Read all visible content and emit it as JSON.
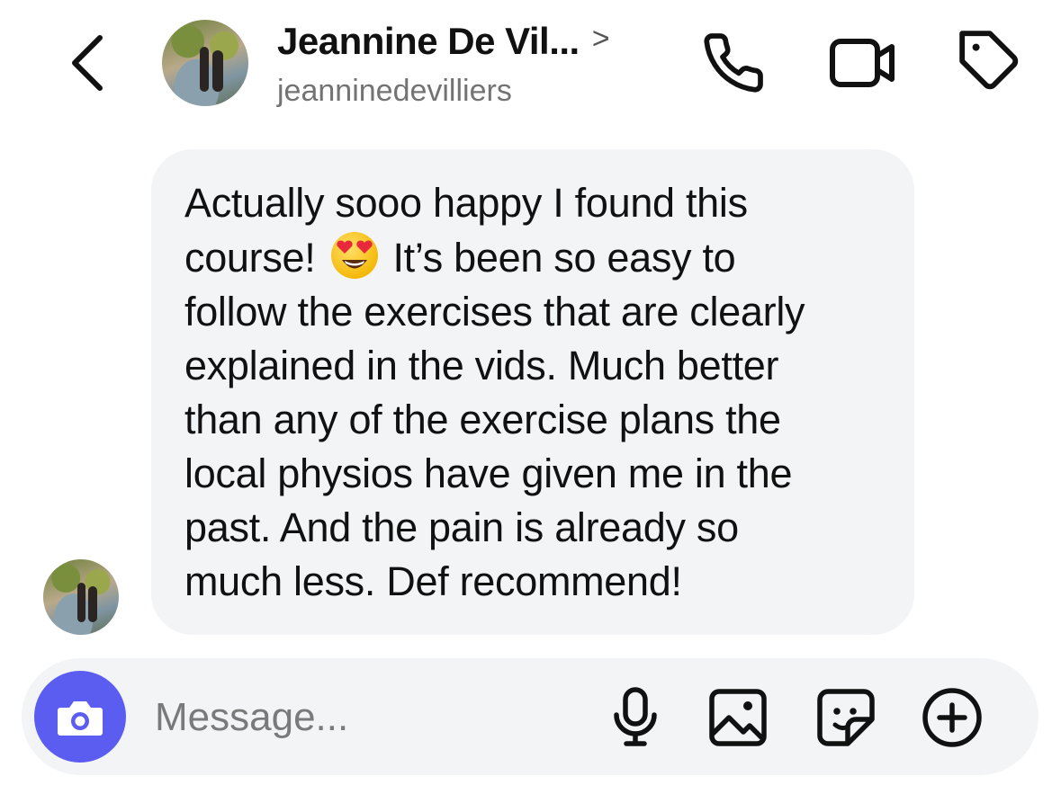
{
  "header": {
    "contact_name": "Jeannine De Vil...",
    "chevron": ">",
    "username": "jeanninedevilliers",
    "icons": {
      "back": "chevron-left-icon",
      "call": "phone-icon",
      "video": "video-camera-icon",
      "tag": "tag-icon"
    }
  },
  "conversation": {
    "message": {
      "text_before_emoji": "Actually sooo happy I found this\ncourse!",
      "emoji": "heart-eyes-emoji",
      "text_after_emoji": "It’s been so easy to\nfollow the exercises that are clearly\nexplained in the vids. Much better\nthan any of the exercise plans the\nlocal physios have given me in the\npast. And the pain is already so\nmuch less. Def recommend!"
    }
  },
  "composer": {
    "placeholder": "Message...",
    "value": "",
    "accent_color": "#5b5cf0",
    "icons": {
      "camera": "camera-icon",
      "mic": "microphone-icon",
      "gallery": "image-icon",
      "sticker": "sticker-icon",
      "add": "plus-circle-icon"
    }
  },
  "colors": {
    "bubble_background": "#f3f4f6",
    "secondary_text": "#737373"
  }
}
